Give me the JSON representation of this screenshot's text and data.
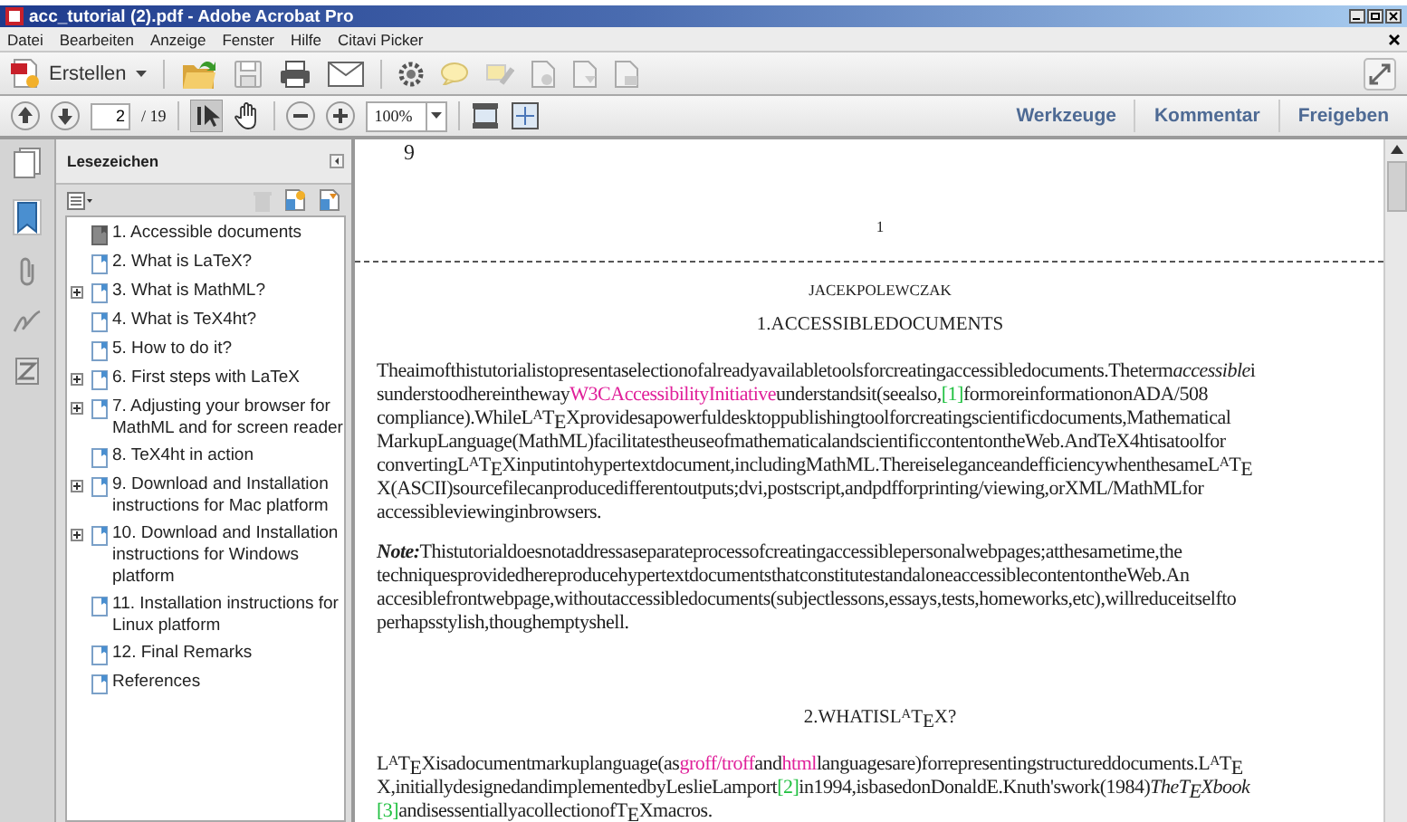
{
  "window": {
    "title": "acc_tutorial (2).pdf - Adobe Acrobat Pro"
  },
  "menu": [
    "Datei",
    "Bearbeiten",
    "Anzeige",
    "Fenster",
    "Hilfe",
    "Citavi Picker"
  ],
  "toolbar": {
    "create_label": "Erstellen"
  },
  "nav": {
    "page": "2",
    "page_count": "/ 19",
    "zoom": "100%"
  },
  "panel_tabs": [
    "Werkzeuge",
    "Kommentar",
    "Freigeben"
  ],
  "bookmarks_panel": {
    "title": "Lesezeichen"
  },
  "bookmarks": [
    {
      "label": "1. Accessible documents",
      "kind": "leaf",
      "selected": true
    },
    {
      "label": "2. What is LaTeX?",
      "kind": "leaf",
      "selected": false
    },
    {
      "label": "3. What is MathML?",
      "kind": "collapsed",
      "selected": false
    },
    {
      "label": "4. What is TeX4ht?",
      "kind": "leaf",
      "selected": false
    },
    {
      "label": "5. How to do it?",
      "kind": "leaf",
      "selected": false
    },
    {
      "label": "6. First steps with LaTeX",
      "kind": "collapsed",
      "selected": false
    },
    {
      "label": "7. Adjusting your browser for MathML and for screen reader",
      "kind": "collapsed",
      "selected": false
    },
    {
      "label": "8. TeX4ht in action",
      "kind": "leaf",
      "selected": false
    },
    {
      "label": "9. Download and Installation instructions for Mac platform",
      "kind": "collapsed",
      "selected": false
    },
    {
      "label": "10. Download and Installation instructions for Windows platform",
      "kind": "collapsed",
      "selected": false
    },
    {
      "label": "11. Installation instructions for Linux platform",
      "kind": "leaf",
      "selected": false
    },
    {
      "label": "12. Final Remarks",
      "kind": "leaf",
      "selected": false
    },
    {
      "label": "References",
      "kind": "leaf",
      "selected": false
    }
  ],
  "document": {
    "previous_page_number": "9",
    "page_number": "1",
    "author": "JACEKPOLEWCZAK",
    "blocks": [
      {
        "kind": "heading",
        "text": "1.ACCESSIBLEDOCUMENTS"
      },
      {
        "kind": "paragraph",
        "lines": [
          [
            {
              "kind": "text",
              "text": "Theaimofthistutorialistopresentaselectionofalreadyavailabletoolsforcreatingaccessibledocuments.Theterm"
            },
            {
              "kind": "italic",
              "text": "accessible"
            },
            {
              "kind": "text",
              "text": "i"
            }
          ],
          [
            {
              "kind": "text",
              "text": "sunderstoodhereintheway"
            },
            {
              "kind": "link",
              "text": "W3CAccessibilityInitiative"
            },
            {
              "kind": "text",
              "text": "understandsit(seealso,"
            },
            {
              "kind": "cite",
              "text": "[1]"
            },
            {
              "kind": "text",
              "text": "formoreinformationonADA/508"
            }
          ],
          [
            {
              "kind": "text",
              "text": "compliance).WhileL$^{A}$T$_{E}$Xprovidesapowerfuldesktoppublishingtoolforcreatingscientificdocuments,Mathematical"
            }
          ],
          [
            {
              "kind": "text",
              "text": "MarkupLanguage(MathML)facilitatestheuseofmathematicalandscientificcontentontheWeb.AndTeX4htisatoolfor"
            }
          ],
          [
            {
              "kind": "text",
              "text": "convertingL$^{A}$T$_{E}$Xinputintohypertextdocument,includingMathML.ThereiseleganceandefficiencywhenthesameL$^{A}$T$_{E}$"
            }
          ],
          [
            {
              "kind": "text",
              "text": "X(ASCII)sourcefilecanproducedifferentoutputs;dvi,postscript,andpdfforprinting/viewing,orXML/MathMLfor"
            }
          ],
          [
            {
              "kind": "text",
              "text": "accessibleviewinginbrowsers."
            }
          ]
        ]
      },
      {
        "kind": "paragraph",
        "lines": [
          [
            {
              "kind": "emphasis",
              "text": "Note:"
            },
            {
              "kind": "text",
              "text": "Thistutorialdoesnotaddressaseparateprocessofcreatingaccessiblepersonalwebpages;atthesametime,the"
            }
          ],
          [
            {
              "kind": "text",
              "text": "techniquesprovidedhereproducehypertextdocumentsthatconstitutestandaloneaccessiblecontentontheWeb.An"
            }
          ],
          [
            {
              "kind": "text",
              "text": "accesiblefrontwebpage,withoutaccessibledocuments(subjectlessons,essays,tests,homeworks,etc),willreduceitselfto"
            }
          ],
          [
            {
              "kind": "text",
              "text": "perhapsstylish,thoughemptyshell."
            }
          ]
        ]
      },
      {
        "kind": "heading",
        "text": "2.WHATISL$^{A}$T$_{E}$X?"
      },
      {
        "kind": "paragraph",
        "lines": [
          [
            {
              "kind": "text",
              "text": "L$^{A}$T$_{E}$Xisadocumentmarkuplanguage(as"
            },
            {
              "kind": "link",
              "text": "groff/troff"
            },
            {
              "kind": "text",
              "text": "and"
            },
            {
              "kind": "link",
              "text": "html"
            },
            {
              "kind": "text",
              "text": "languagesare)forrepresentingstructureddocuments.L$^{A}$T$_{E}$"
            }
          ],
          [
            {
              "kind": "text",
              "text": "X,initiallydesignedandimplementedbyLeslieLamport"
            },
            {
              "kind": "cite",
              "text": "[2]"
            },
            {
              "kind": "text",
              "text": "in1994,isbasedonDonaldE.Knuth'swork(1984)"
            },
            {
              "kind": "italic",
              "text": "TheT$_{E}$Xbook"
            }
          ],
          [
            {
              "kind": "cite",
              "text": "[3]"
            },
            {
              "kind": "text",
              "text": "andisessentiallyacollectionofT$_{E}$Xmacros."
            }
          ]
        ]
      }
    ]
  }
}
